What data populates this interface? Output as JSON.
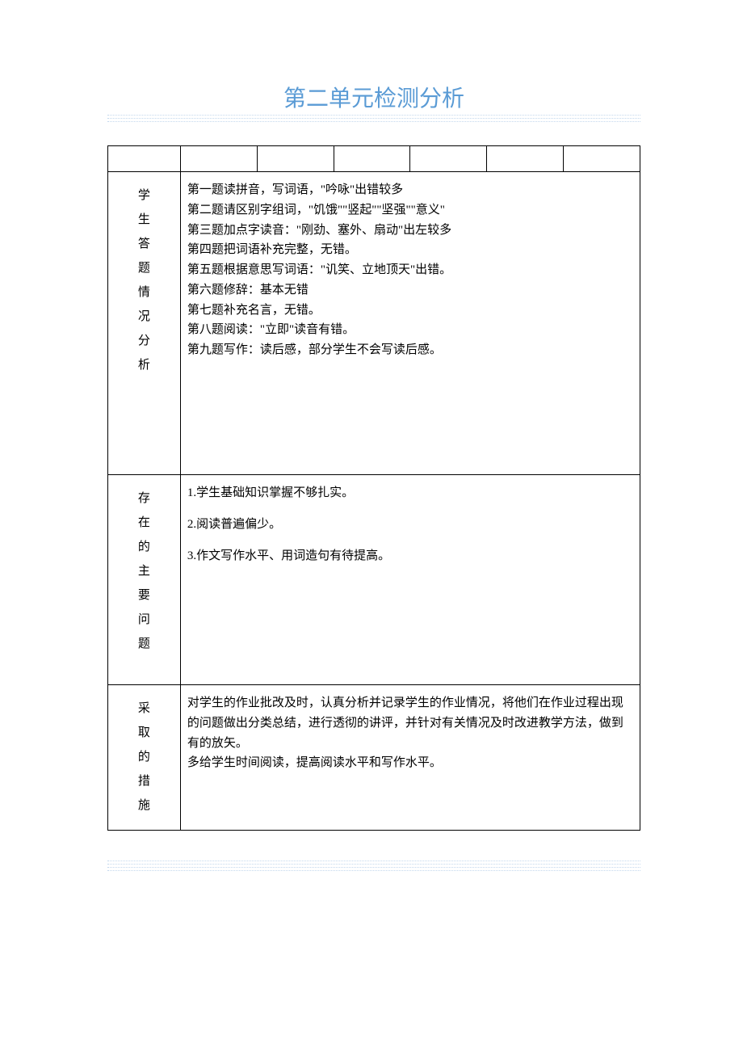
{
  "title": "第二单元检测分析",
  "sections": {
    "analysis": {
      "label": "学生答题情况分析",
      "lines": [
        "第一题读拼音，写词语，\"吟咏\"出错较多",
        "第二题请区别字组词，\"饥饿\"\"竖起\"\"坚强\"\"意义\"",
        "第三题加点字读音：\"刚劲、塞外、扇动\"出左较多",
        "第四题把词语补充完整，无错。",
        "第五题根据意思写词语：\"讥笑、立地顶天\"出错。",
        "第六题修辞：基本无错",
        "第七题补充名言，无错。",
        "第八题阅读：\"立即\"读音有错。",
        "第九题写作：读后感，部分学生不会写读后感。"
      ]
    },
    "problems": {
      "label": "存在的主要问题",
      "lines": [
        "1.学生基础知识掌握不够扎实。",
        "2.阅读普遍偏少。",
        "3.作文写作水平、用词造句有待提高。"
      ]
    },
    "measures": {
      "label": "采取的措施",
      "lines": [
        "对学生的作业批改及时，认真分析并记录学生的作业情况，将他们在作业过程出现的问题做出分类总结，进行透彻的讲评，并针对有关情况及时改进教学方法，做到有的放矢。",
        "多给学生时间阅读，提高阅读水平和写作水平。"
      ]
    }
  }
}
